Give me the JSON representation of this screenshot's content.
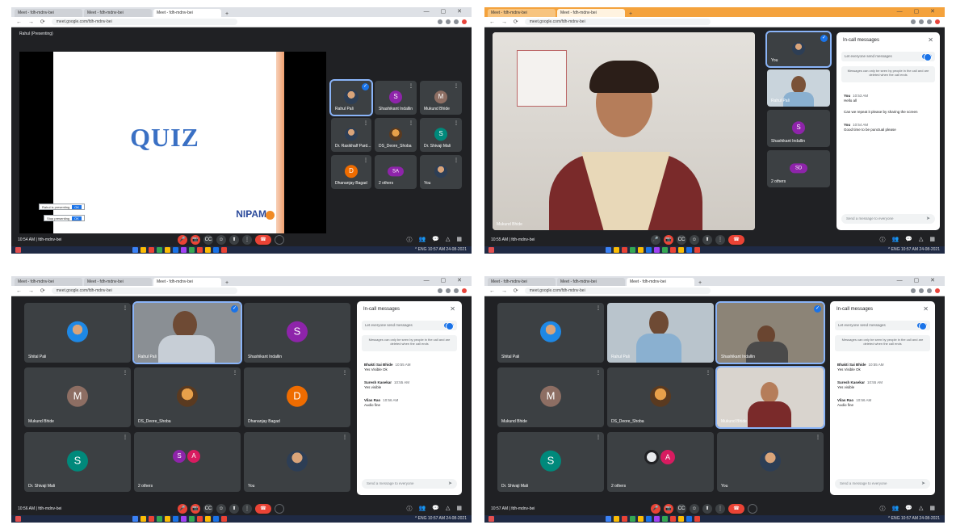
{
  "browser": {
    "tab_labels": [
      "Meet - fdh-mdnv-bei",
      "Meet - fdh-mdnv-bei",
      "Meet - fdh-mdnv-bei"
    ],
    "url": "meet.google.com/fdh-mdnv-bei",
    "window_controls": "— ▢ ✕",
    "nav": "← → ⟳"
  },
  "q1": {
    "presenting_label": "Rahul (Presenting)",
    "slide_title": "QUIZ",
    "slide_logo": "NIPAM",
    "popup_1": "Rahul is presenting",
    "popup_2": "Stop presenting",
    "popup_btn": "OK",
    "tiles": [
      {
        "name": "Rahul Pali",
        "initial": "",
        "color": "#5f6368"
      },
      {
        "name": "Shashikant Indallin",
        "initial": "S",
        "color": "#8e24aa"
      },
      {
        "name": "Mukund Bhide",
        "initial": "M",
        "color": "#8d6e63"
      },
      {
        "name": "Dr. Rasikhalf Pard...",
        "initial": "",
        "color": "#5f6368"
      },
      {
        "name": "DS_Deore_Shoba",
        "initial": "",
        "color": "#5f6368"
      },
      {
        "name": "Dr. Shivaji Mali",
        "initial": "S",
        "color": "#00897b"
      },
      {
        "name": "Dhananjay Bagad",
        "initial": "D",
        "color": "#ef6c00"
      },
      {
        "name": "2 others",
        "initial": "SA",
        "color": "#8e24aa"
      },
      {
        "name": "You",
        "initial": "",
        "color": "#5f6368"
      }
    ],
    "meta": "10:54 AM | fdh-mdnv-bei"
  },
  "q2": {
    "main_name": "Mukund Bhide",
    "tiles": [
      {
        "name": "You"
      },
      {
        "name": "Rahul Pali"
      },
      {
        "name": "Shashikant Indallin",
        "initial": "S"
      },
      {
        "name": "2 others",
        "initial": "SD"
      }
    ],
    "meta": "10:55 AM | fdh-mdnv-bei"
  },
  "q3": {
    "tiles": [
      {
        "name": "Shital Pali",
        "initial": "",
        "color": "#1e88e5"
      },
      {
        "name": "Rahul Pali",
        "initial": "",
        "color": ""
      },
      {
        "name": "Shashikant Indallin",
        "initial": "S",
        "color": "#8e24aa"
      },
      {
        "name": "Mukund Bhide",
        "initial": "M",
        "color": "#8d6e63"
      },
      {
        "name": "DS_Deore_Shoba",
        "initial": "",
        "color": ""
      },
      {
        "name": "Dhananjay Bagad",
        "initial": "D",
        "color": "#ef6c00"
      },
      {
        "name": "Dr. Shivaji Mali",
        "initial": "S",
        "color": "#00897b"
      },
      {
        "name": "2 others",
        "initial": "SA",
        "color": ""
      },
      {
        "name": "You",
        "initial": "",
        "color": ""
      }
    ],
    "meta": "10:56 AM | fdh-mdnv-bei"
  },
  "q4": {
    "tiles": [
      {
        "name": "Shital Pali",
        "initial": "",
        "color": "#1e88e5"
      },
      {
        "name": "Rahul Pali",
        "initial": "",
        "color": ""
      },
      {
        "name": "Shashikant Indallin",
        "initial": "",
        "color": ""
      },
      {
        "name": "Mukund Bhide",
        "initial": "M",
        "color": "#8d6e63"
      },
      {
        "name": "DS_Deore_Shoba",
        "initial": "",
        "color": ""
      },
      {
        "name": "Mukund Bhide",
        "initial": "",
        "color": ""
      },
      {
        "name": "Dr. Shivaji Mali",
        "initial": "S",
        "color": "#00897b"
      },
      {
        "name": "2 others",
        "initial": "A",
        "color": "#d81b60"
      },
      {
        "name": "You",
        "initial": "",
        "color": ""
      }
    ],
    "meta": "10:57 AM | fdh-mdnv-bei"
  },
  "chat": {
    "title": "In-call messages",
    "toggle_label": "Let everyone send messages",
    "info": "Messages can only be seen by people in the call and are deleted when the call ends",
    "send_placeholder": "Send a message to everyone",
    "send_icon": "➤",
    "close": "✕",
    "messages_q2": [
      {
        "sender": "You",
        "time": "10:53 AM",
        "text": "Hello all"
      },
      {
        "sender": "",
        "time": "",
        "text": "Can we repeat it please by sharing the screen"
      },
      {
        "sender": "You",
        "time": "10:54 AM",
        "text": "Good time to be punctual please"
      }
    ],
    "messages_q3": [
      {
        "sender": "Bhakti Sai Bhide",
        "time": "10:55 AM",
        "text": "Yes Visible Ok"
      },
      {
        "sender": "Suresh Kasekar",
        "time": "10:55 AM",
        "text": "Yes visible"
      },
      {
        "sender": "Vilas Rao",
        "time": "10:56 AM",
        "text": "Audio fine"
      }
    ]
  },
  "controls": {
    "mic": "🎤",
    "cam": "📷",
    "cc": "CC",
    "emoji": "☺",
    "present": "⬆",
    "more": "⋮",
    "end": "☎",
    "right": [
      "ⓘ",
      "👥",
      "💬",
      "△",
      "▦"
    ]
  },
  "taskbar": {
    "tray": "^ ENG 10:57 AM 24-08-2021"
  }
}
